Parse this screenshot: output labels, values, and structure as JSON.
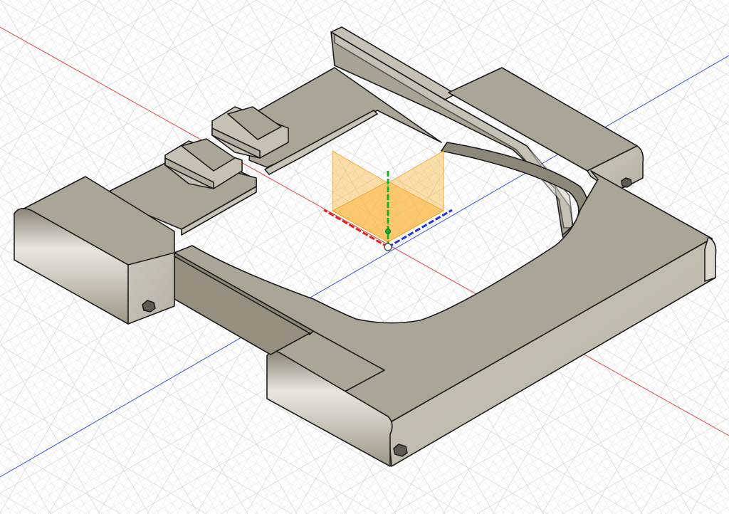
{
  "canvas": {
    "view": "isometric",
    "background_color": "#ffffff",
    "grid": true,
    "grid_minor_color": "#e3e3e3",
    "grid_major_color": "#cccccc"
  },
  "axes": {
    "x_axis_color": "#e34a4a",
    "y_axis_color": "#1bbf2a",
    "z_axis_color": "#3a4fe0"
  },
  "model": {
    "top_face_color": "#aaa597",
    "side_face_color": "#c6c1b4",
    "shadow_face_color": "#86806f",
    "edge_color": "#1d1d1d",
    "hole_icon": "hex-hole-icon"
  },
  "origin_planes": {
    "fill_color": "#f9b640",
    "opacity": 0.5
  }
}
